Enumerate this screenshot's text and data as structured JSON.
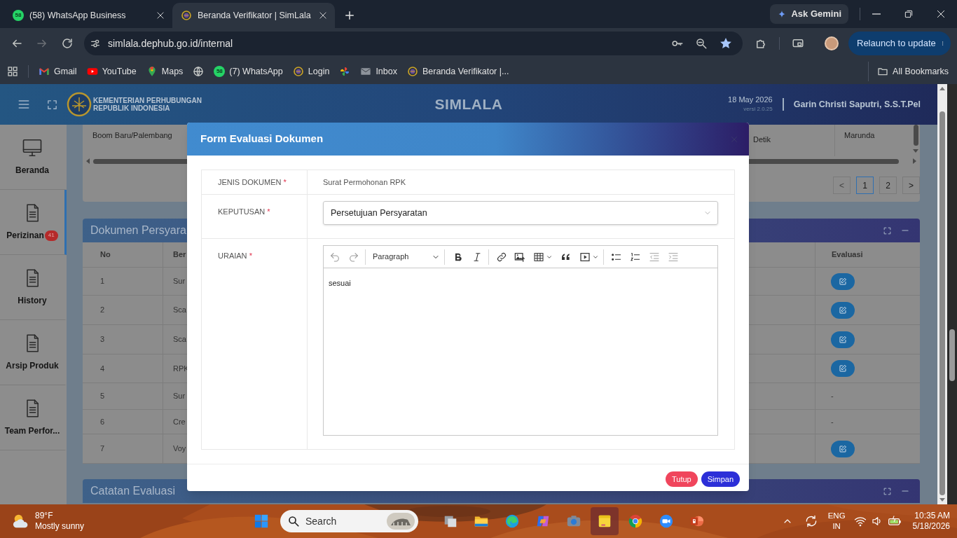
{
  "browser": {
    "tabs": [
      {
        "title": "(58) WhatsApp Business",
        "kind": "whatsapp",
        "badge": "58",
        "selected": false
      },
      {
        "title": "Beranda Verifikator | SimLala",
        "kind": "site",
        "selected": true
      }
    ],
    "gemini_button": "Ask Gemini",
    "url": "simlala.dephub.go.id/internal",
    "relaunch_button": "Relaunch to update",
    "bookmarks": [
      {
        "kind": "gmail",
        "label": "Gmail"
      },
      {
        "kind": "youtube",
        "label": "YouTube"
      },
      {
        "kind": "maps",
        "label": "Maps"
      },
      {
        "kind": "globe"
      },
      {
        "kind": "whatsapp",
        "badge": "58",
        "label": "(7) WhatsApp"
      },
      {
        "kind": "site",
        "label": "Login"
      },
      {
        "kind": "pinwheel"
      },
      {
        "kind": "mail",
        "label": "Inbox"
      },
      {
        "kind": "site",
        "label": "Beranda Verifikator |..."
      }
    ],
    "all_bookmarks": "All Bookmarks"
  },
  "app": {
    "header": {
      "org_line_1": "KEMENTERIAN PERHUBUNGAN",
      "org_line_2": "REPUBLIK INDONESIA",
      "title": "SIMLALA",
      "date": "18 May 2026",
      "version": "versi 2.0.25",
      "user": "Garin Christi Saputri, S.S.T.Pel"
    },
    "sidebar": [
      {
        "label": "Beranda",
        "kind": "monitor",
        "selected": false
      },
      {
        "label": "Perizinan",
        "kind": "document",
        "badge": "41",
        "selected": true
      },
      {
        "label": "History",
        "kind": "document",
        "selected": false
      },
      {
        "label": "Arsip Produk",
        "kind": "document",
        "selected": false
      },
      {
        "label": "Team Perfor...",
        "kind": "document",
        "selected": false
      }
    ],
    "upper_table": {
      "visible_cells": [
        "Boom Baru/Palembang",
        "Detik",
        "Marunda"
      ],
      "pagination": [
        {
          "label": "<",
          "disabled": true,
          "selected": false
        },
        {
          "label": "1",
          "disabled": false,
          "selected": true
        },
        {
          "label": "2",
          "disabled": false,
          "selected": false
        },
        {
          "label": ">",
          "disabled": false,
          "selected": false
        }
      ]
    },
    "documents_panel": {
      "title": "Dokumen Persyara",
      "columns": [
        "No",
        "Ber",
        "Evaluasi"
      ],
      "rows": [
        {
          "no": "1",
          "document": "Sur",
          "evaluation": {
            "kind": "edit"
          }
        },
        {
          "no": "2",
          "document": "Sca",
          "evaluation": {
            "kind": "edit"
          }
        },
        {
          "no": "3",
          "document": "Sca",
          "evaluation": {
            "kind": "edit"
          }
        },
        {
          "no": "4",
          "document": "RPK",
          "evaluation": {
            "kind": "edit"
          }
        },
        {
          "no": "5",
          "document": "Sur",
          "evaluation": {
            "kind": "text",
            "text": "-"
          }
        },
        {
          "no": "6",
          "document": "Cre",
          "evaluation": {
            "kind": "text",
            "text": "-"
          }
        },
        {
          "no": "7",
          "document": "Voy",
          "evaluation": {
            "kind": "edit"
          }
        }
      ]
    },
    "notes_panel": {
      "title": "Catatan Evaluasi"
    }
  },
  "modal": {
    "title": "Form Evaluasi Dokumen",
    "fields": [
      {
        "label": "JENIS DOKUMEN",
        "required_mark": "*",
        "kind": "text",
        "value": "Surat Permohonan RPK"
      },
      {
        "label": "KEPUTUSAN",
        "required_mark": "*",
        "kind": "select",
        "value": "Persetujuan Persyaratan"
      },
      {
        "label": "URAIAN",
        "required_mark": "*",
        "kind": "editor",
        "block_style": "Paragraph",
        "value": "sesuai"
      }
    ],
    "buttons": [
      {
        "label": "Tutup",
        "kind": "close"
      },
      {
        "label": "Simpan",
        "kind": "save"
      }
    ]
  },
  "taskbar": {
    "weather": {
      "temperature": "89°F",
      "condition": "Mostly sunny"
    },
    "search": {
      "placeholder": "Search"
    },
    "apps": [
      {
        "kind": "taskview",
        "selected": false
      },
      {
        "kind": "explorer",
        "selected": false
      },
      {
        "kind": "edge",
        "selected": false
      },
      {
        "kind": "copilot",
        "selected": false
      },
      {
        "kind": "camera",
        "selected": false
      },
      {
        "kind": "notes",
        "selected": true
      },
      {
        "kind": "chrome",
        "selected": false
      },
      {
        "kind": "zoom",
        "selected": false
      },
      {
        "kind": "powerpoint",
        "selected": false
      }
    ],
    "tray": {
      "language": "ENG",
      "region": "IN",
      "time": "10:35 AM",
      "date": "5/18/2026"
    }
  }
}
